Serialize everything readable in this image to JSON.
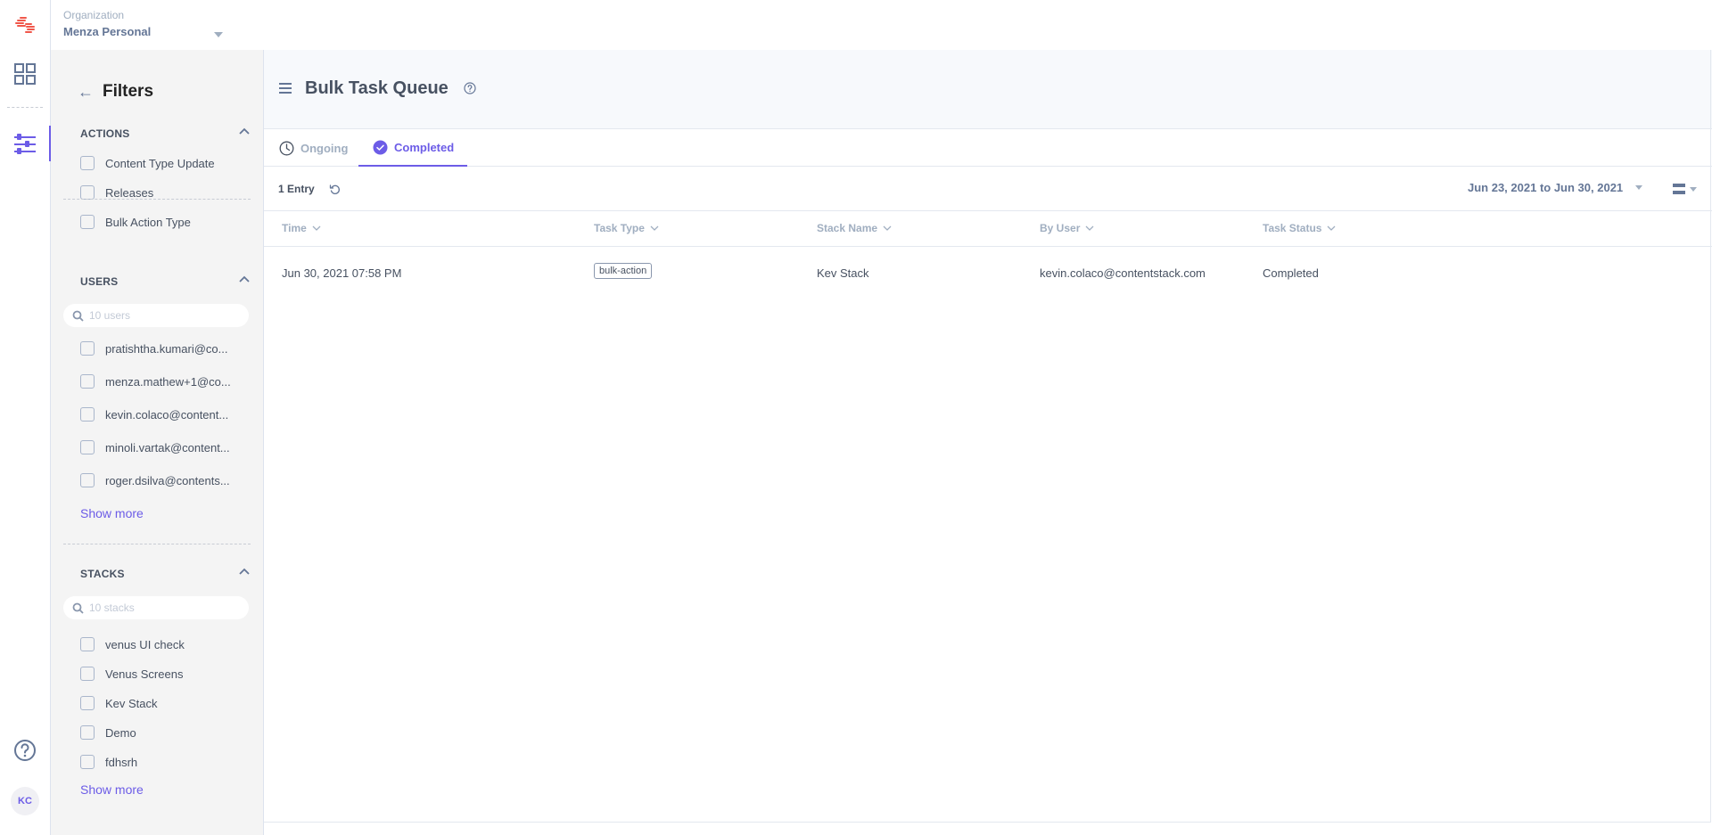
{
  "org": {
    "label": "Organization",
    "name": "Menza Personal"
  },
  "user": {
    "initials": "KC"
  },
  "filters": {
    "title": "Filters",
    "actions": {
      "heading": "ACTIONS",
      "items": [
        "Content Type Update",
        "Releases",
        "Bulk Action Type"
      ]
    },
    "users": {
      "heading": "USERS",
      "search_placeholder": "10 users",
      "items": [
        "pratishtha.kumari@co...",
        "menza.mathew+1@co...",
        "kevin.colaco@content...",
        "minoli.vartak@content...",
        "roger.dsilva@contents..."
      ],
      "show_more": "Show more"
    },
    "stacks": {
      "heading": "STACKS",
      "search_placeholder": "10 stacks",
      "items": [
        "venus UI check",
        "Venus Screens",
        "Kev Stack",
        "Demo",
        "fdhsrh"
      ],
      "show_more": "Show more"
    }
  },
  "page": {
    "title": "Bulk Task Queue",
    "tabs": [
      {
        "label": "Ongoing",
        "icon": "clock-icon",
        "active": false
      },
      {
        "label": "Completed",
        "icon": "check-circle-icon",
        "active": true
      }
    ],
    "entry_count": "1 Entry",
    "date_range": "Jun 23, 2021 to Jun 30, 2021"
  },
  "table": {
    "columns": [
      "Time",
      "Task Type",
      "Stack Name",
      "By User",
      "Task Status"
    ],
    "rows": [
      {
        "time": "Jun 30, 2021 07:58 PM",
        "task_type": "bulk-action",
        "stack_name": "Kev Stack",
        "by_user": "kevin.colaco@contentstack.com",
        "task_status": "Completed"
      }
    ]
  },
  "colors": {
    "accent": "#6c5ce7",
    "logo": "#f0574a",
    "text": "#475161",
    "muted": "#a0aec0"
  }
}
